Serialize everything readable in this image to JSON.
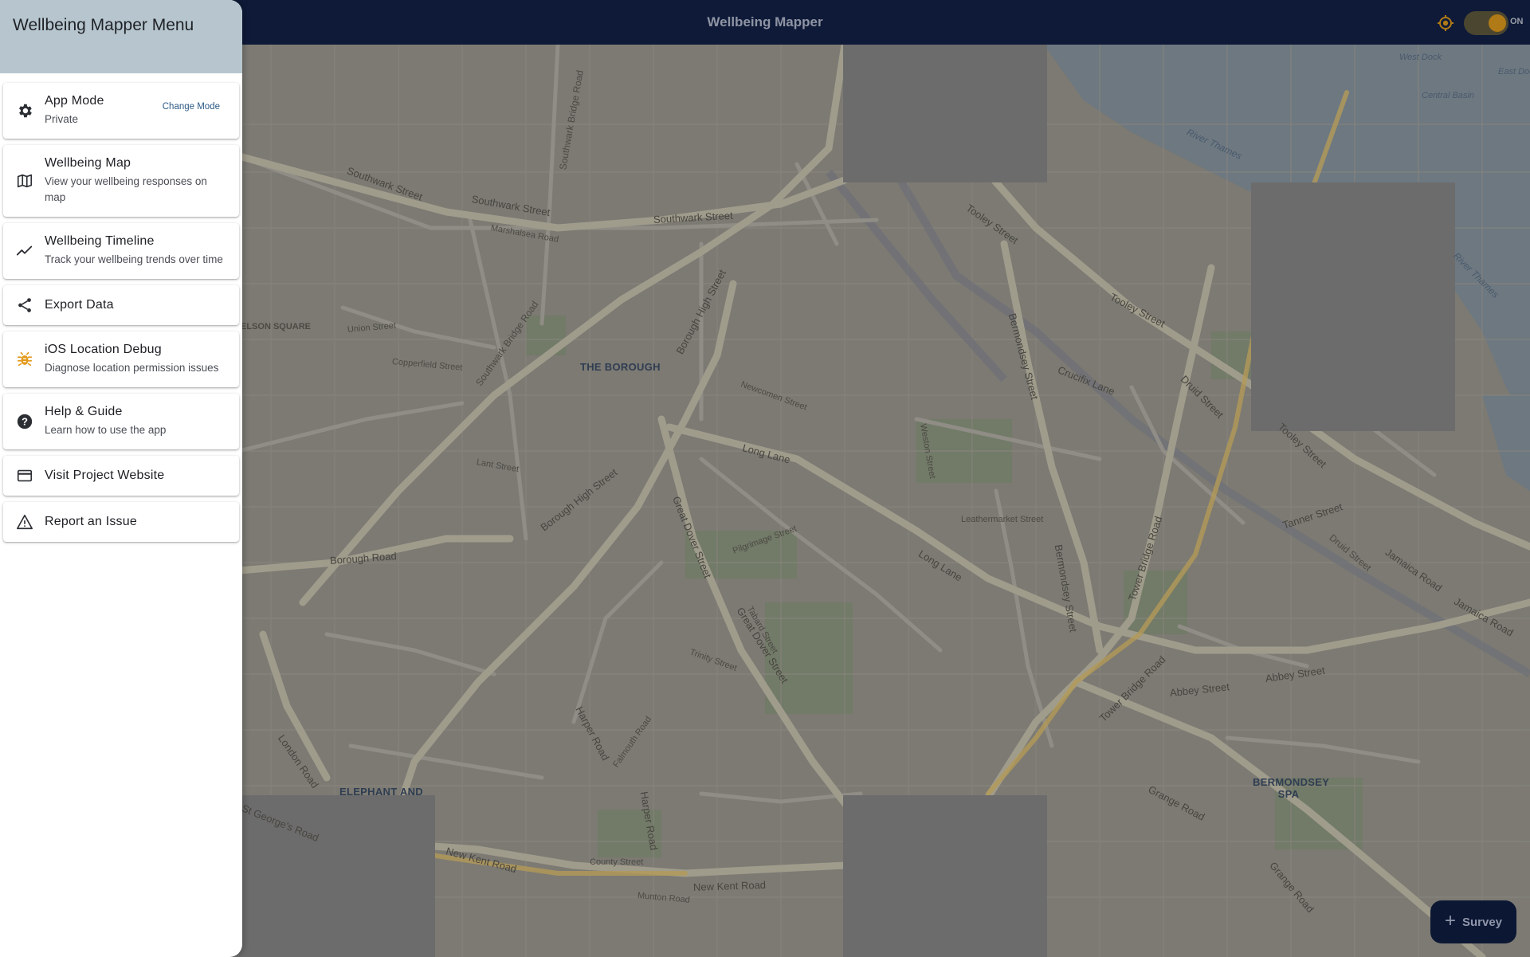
{
  "app": {
    "title": "Wellbeing Mapper",
    "tracking_toggle": {
      "label": "ON",
      "state": "on"
    },
    "survey_button": {
      "label": "Survey",
      "icon": "plus-icon"
    },
    "colors": {
      "appbar": "#0e1a38",
      "drawer_header": "#b7c6ce",
      "accent": "#c88a1a",
      "link": "#2d5a86"
    }
  },
  "drawer": {
    "title": "Wellbeing Mapper Menu",
    "items": [
      {
        "id": "app-mode",
        "icon": "gear-icon",
        "title": "App Mode",
        "subtitle": "Private",
        "action": "Change Mode"
      },
      {
        "id": "wellbeing-map",
        "icon": "map-icon",
        "title": "Wellbeing Map",
        "subtitle": "View your wellbeing responses on map"
      },
      {
        "id": "wellbeing-timeline",
        "icon": "trend-line-icon",
        "title": "Wellbeing Timeline",
        "subtitle": "Track your wellbeing trends over time"
      },
      {
        "id": "export-data",
        "icon": "share-icon",
        "title": "Export Data"
      },
      {
        "id": "ios-location-debug",
        "icon": "bug-icon",
        "title": "iOS Location Debug",
        "subtitle": "Diagnose location permission issues"
      },
      {
        "id": "help-guide",
        "icon": "help-circle-icon",
        "title": "Help & Guide",
        "subtitle": "Learn how to use the app"
      },
      {
        "id": "visit-website",
        "icon": "browser-window-icon",
        "title": "Visit Project Website"
      },
      {
        "id": "report-issue",
        "icon": "warning-triangle-icon",
        "title": "Report an Issue"
      }
    ]
  },
  "map": {
    "places": [
      "THE BOROUGH",
      "ELEPHANT AND",
      "BERMONDSEY SPA",
      "ELSON SQUARE"
    ],
    "streets": [
      "Southwark Street",
      "Southwark Street",
      "Southwark Street",
      "Southwark Bridge Road",
      "Southwark Bridge Road",
      "Borough High Street",
      "Borough High Street",
      "Borough Road",
      "Great Dover Street",
      "Great Dover Street",
      "Long Lane",
      "Long Lane",
      "Tooley Street",
      "Tooley Street",
      "Tooley Street",
      "Bermondsey Street",
      "Bermondsey Street",
      "Crucifix Lane",
      "Druid Street",
      "Druid Street",
      "Tower Bridge Road",
      "Tower Bridge Road",
      "Tanner Street",
      "Jamaica Road",
      "Jamaica Road",
      "Abbey Street",
      "Abbey Street",
      "Grange Road",
      "Grange Road",
      "New Kent Road",
      "New Kent Road",
      "London Road",
      "St George's Road",
      "Harper Road",
      "Harper Road",
      "Union Street",
      "Lant Street",
      "Weston Street",
      "Leathermarket Street",
      "Newcomen Street",
      "Trinity Street",
      "Tabard Street",
      "County Street",
      "Marshalsea Road",
      "Copperfield Street",
      "Pilgrimage Street",
      "Falmouth Road",
      "Munton Road"
    ],
    "water": [
      "River Thames",
      "River Thames",
      "Central Basin",
      "West Dock",
      "East Dock"
    ]
  }
}
